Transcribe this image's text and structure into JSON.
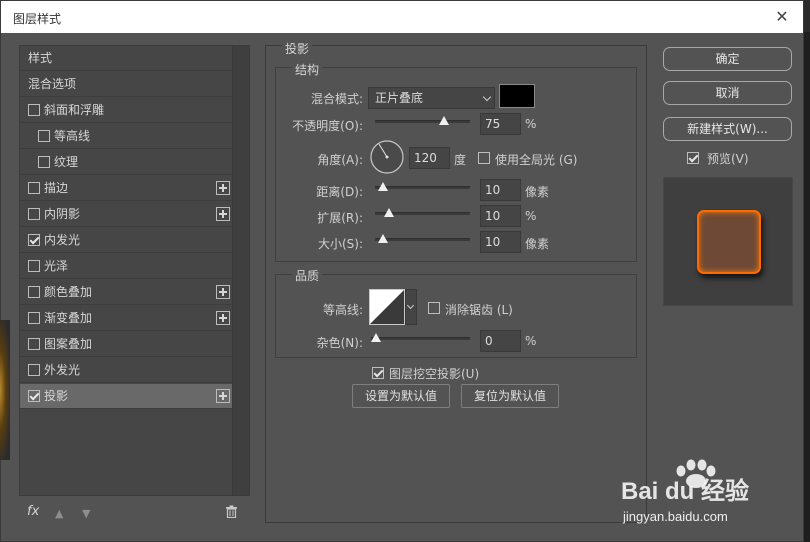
{
  "window": {
    "title": "图层样式"
  },
  "style_list": {
    "items": [
      {
        "label": "样式",
        "checkbox": false,
        "checked": false,
        "plus": false,
        "indent": 0
      },
      {
        "label": "混合选项",
        "checkbox": false,
        "checked": false,
        "plus": false,
        "indent": 0
      },
      {
        "label": "斜面和浮雕",
        "checkbox": true,
        "checked": false,
        "plus": false,
        "indent": 0
      },
      {
        "label": "等高线",
        "checkbox": true,
        "checked": false,
        "plus": false,
        "indent": 1
      },
      {
        "label": "纹理",
        "checkbox": true,
        "checked": false,
        "plus": false,
        "indent": 1
      },
      {
        "label": "描边",
        "checkbox": true,
        "checked": false,
        "plus": true,
        "indent": 0
      },
      {
        "label": "内阴影",
        "checkbox": true,
        "checked": false,
        "plus": true,
        "indent": 0
      },
      {
        "label": "内发光",
        "checkbox": true,
        "checked": true,
        "plus": false,
        "indent": 0
      },
      {
        "label": "光泽",
        "checkbox": true,
        "checked": false,
        "plus": false,
        "indent": 0
      },
      {
        "label": "颜色叠加",
        "checkbox": true,
        "checked": false,
        "plus": true,
        "indent": 0
      },
      {
        "label": "渐变叠加",
        "checkbox": true,
        "checked": false,
        "plus": true,
        "indent": 0
      },
      {
        "label": "图案叠加",
        "checkbox": true,
        "checked": false,
        "plus": false,
        "indent": 0
      },
      {
        "label": "外发光",
        "checkbox": true,
        "checked": false,
        "plus": false,
        "indent": 0
      },
      {
        "label": "投影",
        "checkbox": true,
        "checked": true,
        "plus": true,
        "indent": 0,
        "selected": true
      }
    ],
    "fx_label": "fx"
  },
  "drop_shadow": {
    "title": "投影",
    "structure": {
      "title": "结构",
      "blend_mode_label": "混合模式:",
      "blend_mode_value": "正片叠底",
      "blend_color": "#000000",
      "opacity_label": "不透明度(O):",
      "opacity_value": "75",
      "opacity_unit": "%",
      "opacity_level": 0.75,
      "angle_label": "角度(A):",
      "angle_value": "120",
      "angle_unit": "度",
      "global_light_label": "使用全局光 (G)",
      "global_light_checked": false,
      "distance_label": "距离(D):",
      "distance_value": "10",
      "distance_unit": "像素",
      "distance_level": 0.03,
      "spread_label": "扩展(R):",
      "spread_value": "10",
      "spread_unit": "%",
      "spread_level": 0.1,
      "size_label": "大小(S):",
      "size_value": "10",
      "size_unit": "像素",
      "size_level": 0.04
    },
    "quality": {
      "title": "品质",
      "contour_label": "等高线:",
      "antialias_label": "消除锯齿 (L)",
      "antialias_checked": false,
      "noise_label": "杂色(N):",
      "noise_value": "0",
      "noise_unit": "%",
      "noise_level": 0
    },
    "knockout_label": "图层挖空投影(U)",
    "knockout_checked": true,
    "set_default_label": "设置为默认值",
    "reset_default_label": "复位为默认值"
  },
  "buttons": {
    "ok": "确定",
    "cancel": "取消",
    "new_style": "新建样式(W)...",
    "preview_label": "预览(V)",
    "preview_checked": true
  },
  "watermark": {
    "brand": "Bai du 经验",
    "url": "jingyan.baidu.com"
  },
  "colors": {
    "panel_bg": "#535353",
    "preview_glow": "#ff6a00"
  }
}
